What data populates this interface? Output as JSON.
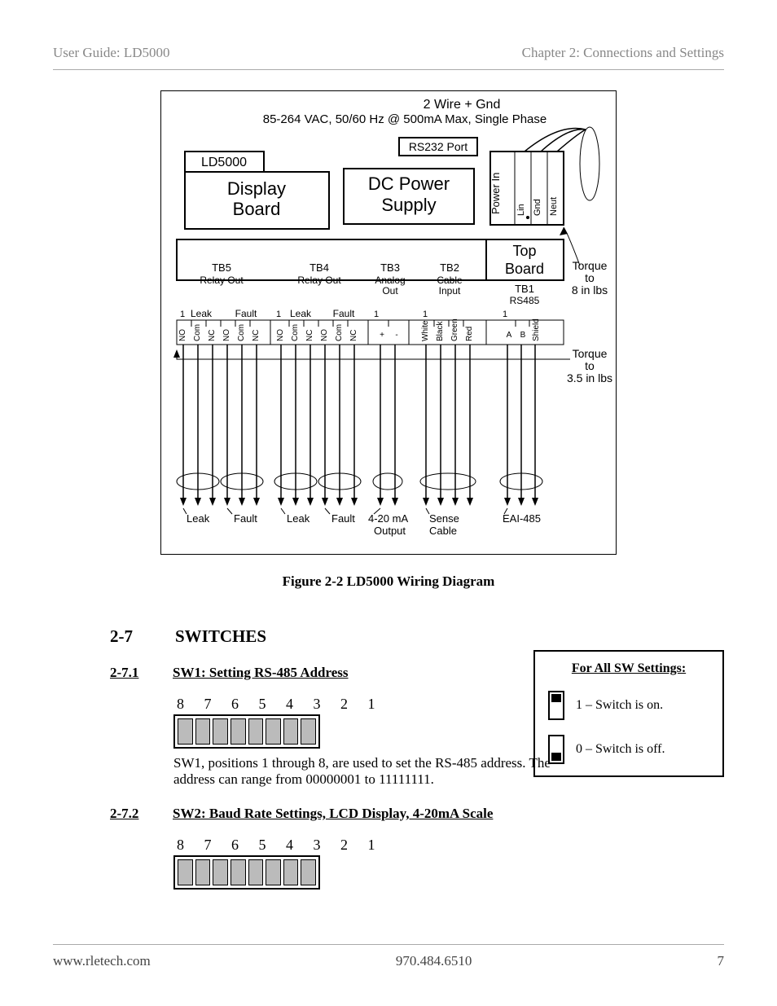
{
  "header": {
    "left": "User Guide: LD5000",
    "right": "Chapter 2: Connections and Settings"
  },
  "figure": {
    "caption": "Figure 2-2 LD5000 Wiring Diagram",
    "header_text": {
      "line1": "2 Wire + Gnd",
      "line2": "85-264 VAC, 50/60 Hz @ 500mA Max, Single Phase"
    },
    "boxes": {
      "ld5000": "LD5000",
      "display_board": [
        "Display",
        "Board"
      ],
      "rs232": "RS232 Port",
      "dc_power": [
        "DC Power",
        "Supply"
      ],
      "power_in": {
        "label": "Power In",
        "pins": [
          "Neut",
          "Gnd",
          "Lin"
        ]
      },
      "top_board": [
        "Top",
        "Board"
      ]
    },
    "terminal_blocks": [
      {
        "name": "TB5",
        "sub": "Relay Out",
        "groups": [
          "Leak",
          "Fault"
        ],
        "pins": [
          "NO",
          "Com",
          "NC",
          "NO",
          "Com",
          "NC"
        ]
      },
      {
        "name": "TB4",
        "sub": "Relay Out",
        "groups": [
          "Leak",
          "Fault"
        ],
        "pins": [
          "NO",
          "Com",
          "NC",
          "NO",
          "Com",
          "NC"
        ]
      },
      {
        "name": "TB3",
        "sub": "Analog Out",
        "pins": [
          "+",
          "-"
        ]
      },
      {
        "name": "TB2",
        "sub": "Cable Input",
        "pins": [
          "White",
          "Black",
          "Green",
          "Red"
        ]
      },
      {
        "name": "TB1",
        "sub": "RS485",
        "pins": [
          "A",
          "B",
          "Shield"
        ]
      }
    ],
    "torque": {
      "a": [
        "Torque",
        "to",
        "8 in lbs"
      ],
      "b": [
        "Torque",
        "to",
        "3.5 in lbs"
      ]
    },
    "bottom_labels": [
      "Leak",
      "Fault",
      "Leak",
      "Fault",
      "4-20 mA Output",
      "Sense Cable",
      "EAI-485"
    ]
  },
  "sections": {
    "s27": {
      "num": "2-7",
      "title": "SWITCHES"
    },
    "s271": {
      "num": "2-7.1",
      "title": "SW1: Setting RS-485 Address",
      "dip_labels": "8  7  6  5  4  3  2  1",
      "body": "SW1, positions 1 through 8, are used to set the RS-485 address.  The address can range from 00000001 to 11111111."
    },
    "s272": {
      "num": "2-7.2",
      "title": "SW2:  Baud Rate Settings, LCD Display, 4-20mA Scale",
      "dip_labels": "8  7  6  5  4  3  2  1"
    }
  },
  "legend": {
    "title": "For All SW Settings:",
    "on": "1 – Switch is on.",
    "off": "0 – Switch is off."
  },
  "footer": {
    "left": "www.rletech.com",
    "center": "970.484.6510",
    "right": "7"
  }
}
